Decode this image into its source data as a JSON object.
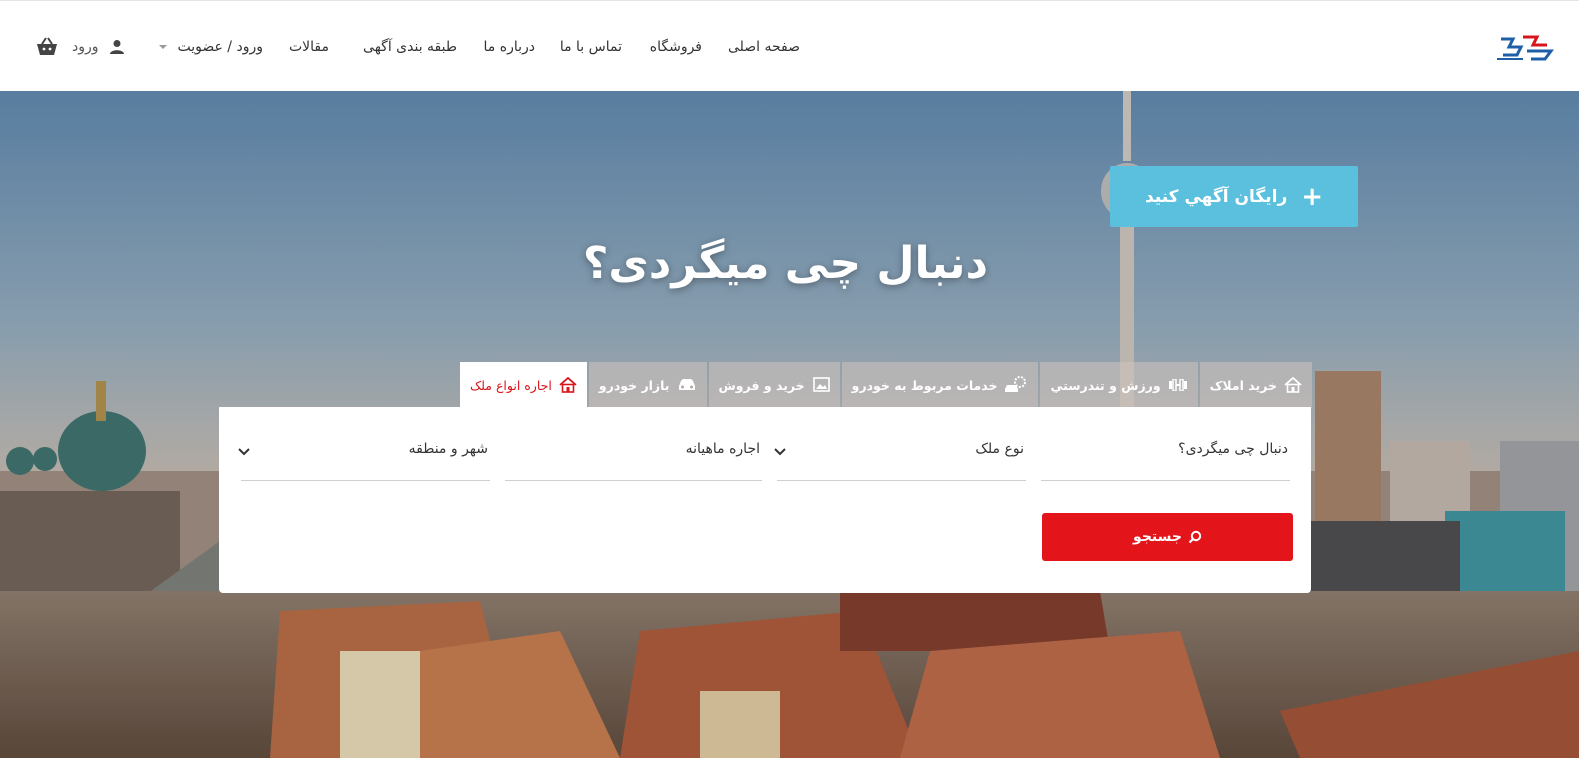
{
  "header": {
    "nav": {
      "home": "صفحه اصلی",
      "shop": "فروشگاه",
      "contact": "تماس با ما",
      "about": "درباره ما",
      "categories": "طبقه بندی آگهی",
      "articles": "مقالات",
      "account": "ورود / عضویت"
    },
    "login_label": "ورود",
    "icons": {
      "user": "user-icon",
      "cart": "basket-icon",
      "logo": "site-logo"
    }
  },
  "hero": {
    "post_ad_label": "رايگان آگهي کنيد",
    "post_ad_icon": "+",
    "title": "دنبال چی میگردی؟",
    "accent_color": "#5bc0de"
  },
  "tabs": [
    {
      "label": "اجاره انواع ملک",
      "icon": "house-icon",
      "active": true
    },
    {
      "label": "بازار خودرو",
      "icon": "car-icon",
      "active": false
    },
    {
      "label": "خرید و فروش",
      "icon": "picture-icon",
      "active": false
    },
    {
      "label": "خدمات مربوط به خودرو",
      "icon": "car-service-icon",
      "active": false
    },
    {
      "label": "ورزش و تندرستي",
      "icon": "dumbbell-icon",
      "active": false
    },
    {
      "label": "خرید املاک",
      "icon": "house-icon",
      "active": false
    }
  ],
  "search": {
    "keyword_placeholder": "دنبال چی میگردی؟",
    "property_type": "نوع ملک",
    "rent_type": "اجاره ماهیانه",
    "location": "شهر و منطقه",
    "button_label": "جستجو",
    "button_color": "#e3141a"
  }
}
